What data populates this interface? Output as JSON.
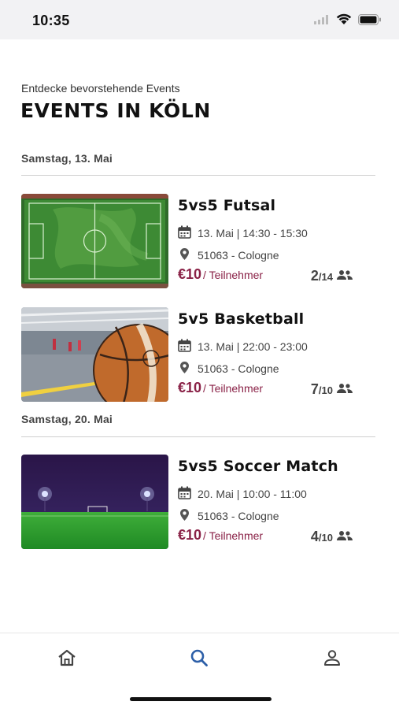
{
  "status_bar": {
    "time": "10:35"
  },
  "header": {
    "subtitle": "Entdecke bevorstehende Events",
    "title": "EVENTS IN KÖLN"
  },
  "groups": [
    {
      "date": "Samstag, 13. Mai",
      "events": [
        {
          "title": "5vs5 Futsal",
          "datetime": "13. Mai | 14:30 - 15:30",
          "location": "51063 - Cologne",
          "price": "€10",
          "per": "/ Teilnehmer",
          "taken": "2",
          "total": "/14",
          "image": "futsal-field-photo"
        },
        {
          "title": "5v5 Basketball",
          "datetime": "13. Mai | 22:00 - 23:00",
          "location": "51063 - Cologne",
          "price": "€10",
          "per": "/ Teilnehmer",
          "taken": "7",
          "total": "/10",
          "image": "basketball-photo"
        }
      ]
    },
    {
      "date": "Samstag, 20. Mai",
      "events": [
        {
          "title": "5vs5 Soccer Match",
          "datetime": "20. Mai | 10:00 - 11:00",
          "location": "51063 - Cologne",
          "price": "€10",
          "per": "/ Teilnehmer",
          "taken": "4",
          "total": "/10",
          "image": "soccer-night-photo"
        }
      ]
    }
  ],
  "bottom_nav": [
    {
      "icon": "home-icon",
      "active": false
    },
    {
      "icon": "search-icon",
      "active": true
    },
    {
      "icon": "profile-icon",
      "active": false
    }
  ],
  "colors": {
    "accent": "#8a2247",
    "nav_active": "#2d5fa8",
    "nav_inactive": "#444444"
  }
}
